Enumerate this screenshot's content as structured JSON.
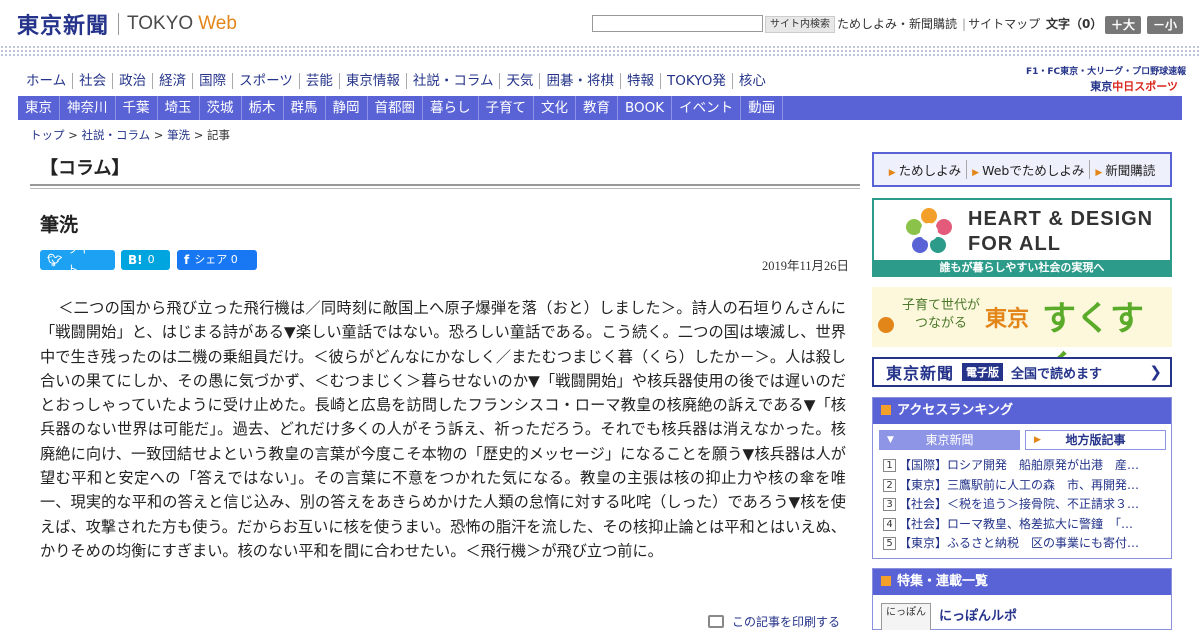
{
  "header": {
    "logo_kanji": "東京新聞",
    "logo_en": "TOKYO",
    "logo_web": "Web",
    "search_button": "サイト内検索",
    "util_links": [
      "ためしよみ・新聞購読",
      "サイトマップ"
    ],
    "font_size_label": "文字（0）",
    "font_plus": "＋大",
    "font_minus": "－小"
  },
  "nav_main": [
    "ホーム",
    "社会",
    "政治",
    "経済",
    "国際",
    "スポーツ",
    "芸能",
    "東京情報",
    "社説・コラム",
    "天気",
    "囲碁・将棋",
    "特報",
    "TOKYO発",
    "核心"
  ],
  "chunichi": {
    "sub": "F1・FC東京・大リーグ・プロ野球速報",
    "main_prefix": "東京",
    "main_name": "中日スポーツ"
  },
  "nav_region": [
    "東京",
    "神奈川",
    "千葉",
    "埼玉",
    "茨城",
    "栃木",
    "群馬",
    "静岡",
    "首都圏",
    "暮らし",
    "子育て",
    "文化",
    "教育",
    "BOOK",
    "イベント",
    "動画"
  ],
  "breadcrumb": {
    "items": [
      "トップ",
      "社説・コラム",
      "筆洗"
    ],
    "current": "記事",
    "sep": ">"
  },
  "article": {
    "section": "【コラム】",
    "title": "筆洗",
    "tweet": "ツイート",
    "hatena_count": "0",
    "facebook": "シェア 0",
    "date": "2019年11月26日",
    "body": "＜二つの国から飛び立った飛行機は／同時刻に敵国上へ原子爆弾を落（おと）しました＞。詩人の石垣りんさんに「戦闘開始」と、はじまる詩がある▼楽しい童話ではない。恐ろしい童話である。こう続く。二つの国は壊滅し、世界中で生き残ったのは二機の乗組員だけ。＜彼らがどんなにかなしく／またむつまじく暮（くら）したか－＞。人は殺し合いの果てにしか、その愚に気づかず、＜むつまじく＞暮らせないのか▼「戦闘開始」や核兵器使用の後では遅いのだとおっしゃっていたように受け止めた。長崎と広島を訪問したフランシスコ・ローマ教皇の核廃絶の訴えである▼「核兵器のない世界は可能だ」。過去、どれだけ多くの人がそう訴え、祈っただろう。それでも核兵器は消えなかった。核廃絶に向け、一致団結せよという教皇の言葉が今度こそ本物の「歴史的メッセージ」になることを願う▼核兵器は人が望む平和と安定への「答えではない」。その言葉に不意をつかれた気になる。教皇の主張は核の抑止力や核の傘を唯一、現実的な平和の答えと信じ込み、別の答えをあきらめかけた人類の怠惰に対する叱咤（しった）であろう▼核を使えば、攻撃された方も使う。だからお互いに核を使うまい。恐怖の脂汗を流した、その核抑止論とは平和とはいえぬ、かりそめの均衡にすぎまい。核のない平和を間に合わせたい。＜飛行機＞が飛び立つ前に。",
    "print_label": "この記事を印刷する"
  },
  "sidebar": {
    "trial_links": [
      "ためしよみ",
      "Webでためしよみ",
      "新聞購読"
    ],
    "heart_design": {
      "line1": "HEART & DESIGN",
      "line2": "FOR ALL",
      "caption": "誰もが暮らしやすい社会の実現へ"
    },
    "sukusuku": {
      "line1": "子育て世代が",
      "line2": "つながる",
      "tokyo": "東京",
      "name": "すくすく"
    },
    "epaper": {
      "logo": "東京新聞",
      "badge": "電子版",
      "text": "全国で読めます"
    },
    "ranking": {
      "title": "アクセスランキング",
      "tab_active": "東京新聞",
      "tab_inactive": "地方版記事",
      "items": [
        {
          "num": "1",
          "text": "【国際】ロシア開発　船舶原発が出港　産…"
        },
        {
          "num": "2",
          "text": "【東京】三鷹駅前に人工の森　市、再開発…"
        },
        {
          "num": "3",
          "text": "【社会】＜税を追う＞接骨院、不正請求３…"
        },
        {
          "num": "4",
          "text": "【社会】ローマ教皇、格差拡大に警鐘　「…"
        },
        {
          "num": "5",
          "text": "【東京】ふるさと納税　区の事業にも寄付…"
        }
      ]
    },
    "features": {
      "title": "特集・連載一覧",
      "thumb": "にっぽん",
      "item_title": "にっぽんルポ"
    }
  },
  "colors": {
    "brand_navy": "#25348a",
    "nav_blue": "#5a63d6",
    "accent_orange": "#e3861a",
    "teal": "#2c9b8a"
  }
}
